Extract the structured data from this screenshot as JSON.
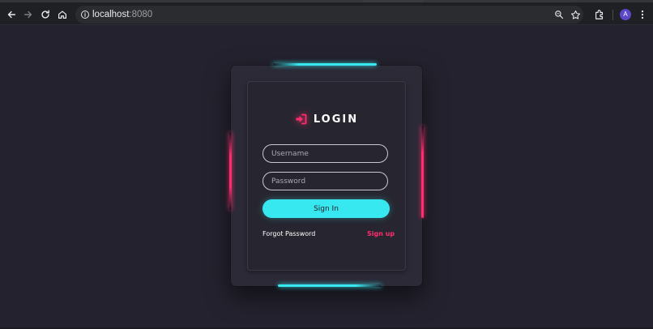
{
  "browser": {
    "url_host": "localhost",
    "url_port": ":8080",
    "profile_initial": "A",
    "icons": [
      "back-icon",
      "forward-icon",
      "reload-icon",
      "home-icon",
      "site-info-icon",
      "zoom-icon",
      "bookmark-star-icon",
      "extensions-icon",
      "menu-icon"
    ]
  },
  "login": {
    "title": "LOGIN",
    "username_placeholder": "Username",
    "password_placeholder": "Password",
    "signin_label": "Sign In",
    "forgot_label": "Forgot Password",
    "signup_label": "Sign up"
  },
  "colors": {
    "background": "#23222e",
    "card": "#2b2a36",
    "accent_cyan": "#38e8f0",
    "accent_pink": "#ff2d6e"
  }
}
